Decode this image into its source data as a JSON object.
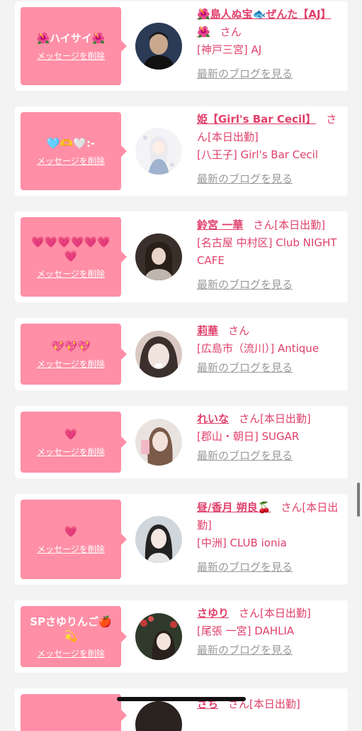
{
  "delete_label": "メッセージを削除",
  "blog_label": "最新のブログを見る",
  "honorific": "さん",
  "colors": {
    "accent": "#e0406b",
    "bubble": "#ff8fa6",
    "link_gray": "#999999",
    "background": "#f3f3f3"
  },
  "cards": [
    {
      "message": "🌺ハイサイ🌺",
      "name": "🌺島人ぬ宝🐟ぜんた【AJ】🌺",
      "status": "",
      "shop": "[神戸三宮] AJ",
      "avatar_icon": "man-portrait-icon"
    },
    {
      "message": "🩵🫶🤍:-",
      "name": "姫【Girl's Bar Cecil】",
      "status": "[本日出勤]",
      "shop": "[八王子] Girl's Bar Cecil",
      "avatar_icon": "anime-girl-icon"
    },
    {
      "message": "💗💗💗💗💗💗💗",
      "name": "鈴宮 一華",
      "status": "[本日出勤]",
      "shop": "[名古屋 中村区] Club NIGHT CAFE",
      "avatar_icon": "woman-portrait-icon"
    },
    {
      "message": "💖💖💖",
      "name": "莉華",
      "status": "",
      "shop": "[広島市（流川）] Antique",
      "avatar_icon": "woman-face-icon"
    },
    {
      "message": "💗",
      "name": "れいな",
      "status": "[本日出勤]",
      "shop": "[郡山・朝日] SUGAR",
      "avatar_icon": "woman-selfie-icon"
    },
    {
      "message": "💗",
      "name": "昼/香月 朔良🍒",
      "status": "[本日出勤]",
      "shop": "[中洲] CLUB ionia",
      "avatar_icon": "woman-portrait-icon"
    },
    {
      "message": "SPさゆりんご🍎💫",
      "name": "さゆり",
      "status": "[本日出勤]",
      "shop": "[尾張 一宮] DAHLIA",
      "avatar_icon": "woman-flowers-icon"
    },
    {
      "message": "",
      "name": "さち",
      "status": "[本日出勤]",
      "shop": "",
      "avatar_icon": "woman-portrait-icon"
    }
  ]
}
